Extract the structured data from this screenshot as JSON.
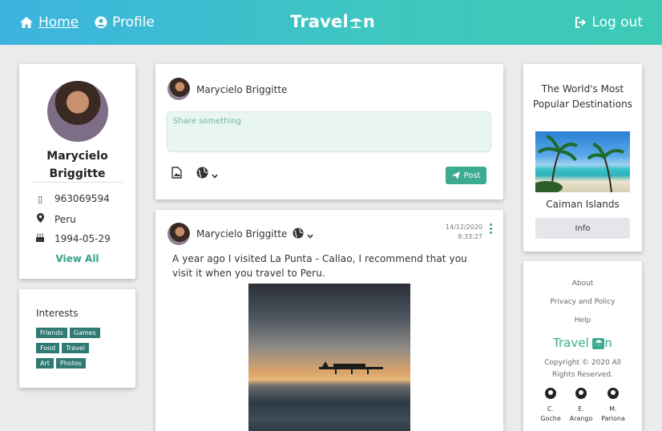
{
  "navbar": {
    "home_label": "Home",
    "profile_label": "Profile",
    "brand_part1": "Travel",
    "brand_part2": "n",
    "logout_label": "Log out"
  },
  "profile": {
    "name": "Marycielo Briggitte",
    "phone": "963069594",
    "country": "Peru",
    "birthday": "1994-05-29",
    "view_all": "View All"
  },
  "interests": {
    "title": "Interests",
    "tags": [
      "Friends",
      "Games",
      "Food",
      "Travel",
      "Art",
      "Photos"
    ]
  },
  "composer": {
    "user_name": "Marycielo Briggitte",
    "placeholder": "Share something",
    "post_label": "Post"
  },
  "post": {
    "user_name": "Marycielo Briggitte",
    "date": "14/12/2020",
    "time": "8:33:27",
    "text": "A year ago I visited La Punta - Callao, I recommend that you visit it when you travel to Peru."
  },
  "destination": {
    "title": "The World's Most Popular Destinations",
    "name": "Caiman Islands",
    "info_label": "Info"
  },
  "footer": {
    "links": [
      "About",
      "Privacy and Policy",
      "Help"
    ],
    "brand_part1": "Travel",
    "brand_part2": "n",
    "copyright": "Copyright © 2020 All Rights Reserved.",
    "authors": [
      {
        "first": "C.",
        "last": "Goche"
      },
      {
        "first": "E.",
        "last": "Arango"
      },
      {
        "first": "M.",
        "last": "Pariona"
      }
    ]
  },
  "colors": {
    "accent": "#3daa92",
    "tag": "#2f7a72",
    "navbar_start": "#3cb3e0",
    "navbar_end": "#3ccab6"
  }
}
